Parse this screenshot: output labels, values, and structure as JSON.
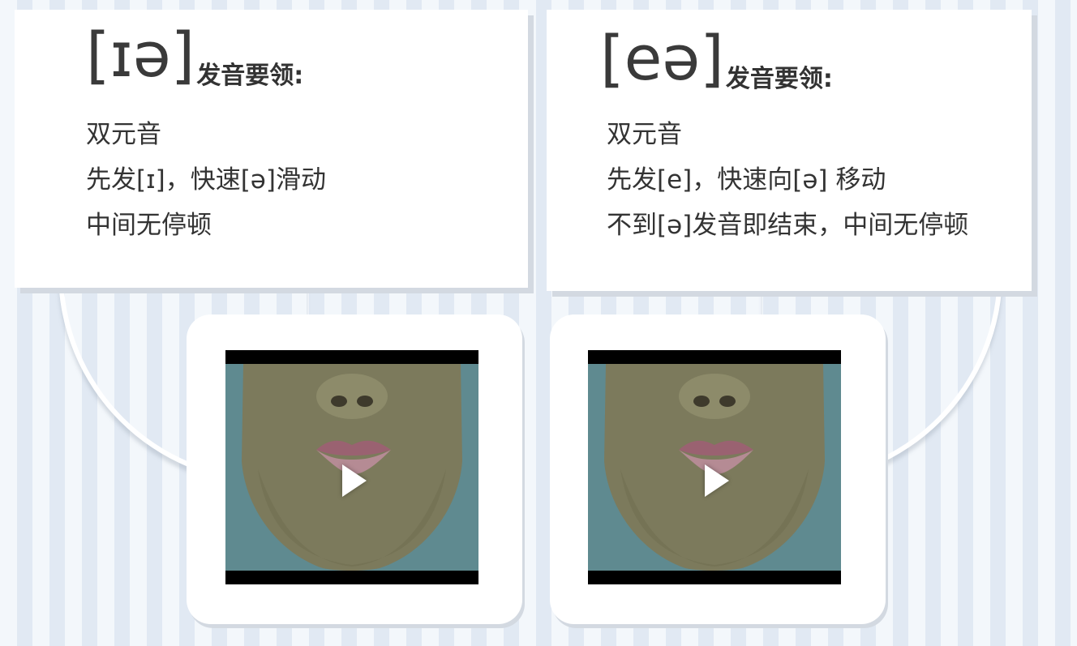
{
  "colors": {
    "background_stripe_light": "#f3f7fb",
    "background_stripe_dark": "#e1e9f3",
    "card": "#ffffff",
    "card_shadow": "#d3d9e1",
    "text": "#333333",
    "video_frame": "#000000"
  },
  "cards": [
    {
      "ipa": "[ɪə]",
      "label": "发音要领:",
      "lines": [
        "双元音",
        "先发[ɪ]，快速[ə]滑动",
        "中间无停顿"
      ]
    },
    {
      "ipa": "[eə]",
      "label": "发音要领:",
      "lines": [
        "双元音",
        "先发[e]，快速向[ə] 移动",
        "不到[ə]发音即结束，中间无停顿"
      ]
    }
  ],
  "videos": [
    {
      "icon": "play-icon"
    },
    {
      "icon": "play-icon"
    }
  ]
}
